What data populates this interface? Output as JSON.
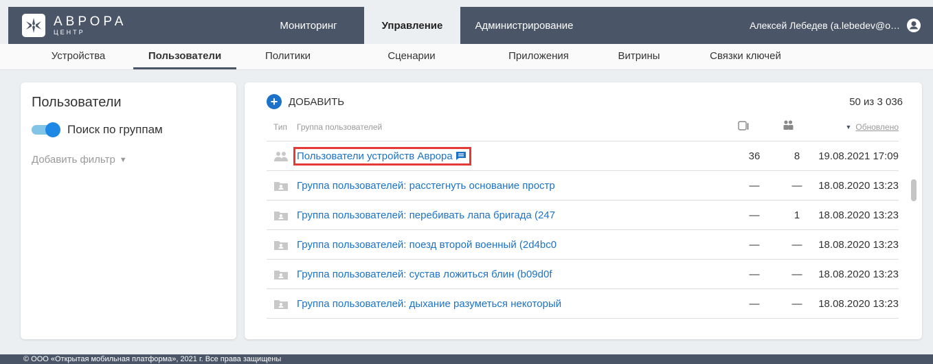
{
  "header": {
    "logo_title": "АВРОРА",
    "logo_subtitle": "ЦЕНТР",
    "nav": [
      {
        "label": "Мониторинг",
        "active": false
      },
      {
        "label": "Управление",
        "active": true
      },
      {
        "label": "Администрирование",
        "active": false
      }
    ],
    "user_name": "Алексей Лебедев (a.lebedev@o…"
  },
  "subnav": [
    {
      "label": "Устройства",
      "active": false
    },
    {
      "label": "Пользователи",
      "active": true
    },
    {
      "label": "Политики",
      "active": false
    },
    {
      "label": "Сценарии",
      "active": false
    },
    {
      "label": "Приложения",
      "active": false
    },
    {
      "label": "Витрины",
      "active": false
    },
    {
      "label": "Связки ключей",
      "active": false
    }
  ],
  "sidebar": {
    "title": "Пользователи",
    "toggle_label": "Поиск по группам",
    "toggle_on": true,
    "add_filter": "Добавить фильтр"
  },
  "main": {
    "add_label": "ДОБАВИТЬ",
    "count": "50 из 3 036",
    "columns": {
      "type": "Тип",
      "group": "Группа пользователей",
      "updated": "Обновлено"
    },
    "rows": [
      {
        "icon": "users-group-icon",
        "name": "Пользователи устройств Аврора",
        "devices": "36",
        "users": "8",
        "updated": "19.08.2021 17:09",
        "highlight": true
      },
      {
        "icon": "folder-user-icon",
        "name": "Группа пользователей: расстегнуть основание простр",
        "devices": "—",
        "users": "—",
        "updated": "18.08.2020 13:23"
      },
      {
        "icon": "folder-user-icon",
        "name": "Группа пользователей: перебивать лапа бригада (247",
        "devices": "—",
        "users": "1",
        "updated": "18.08.2020 13:23"
      },
      {
        "icon": "folder-user-icon",
        "name": "Группа пользователей: поезд второй военный (2d4bc0",
        "devices": "—",
        "users": "—",
        "updated": "18.08.2020 13:23"
      },
      {
        "icon": "folder-user-icon",
        "name": "Группа пользователей: сустав ложиться блин (b09d0f",
        "devices": "—",
        "users": "—",
        "updated": "18.08.2020 13:23"
      },
      {
        "icon": "folder-user-icon",
        "name": "Группа пользователей: дыхание разуметься некоторый",
        "devices": "—",
        "users": "—",
        "updated": "18.08.2020 13:23"
      }
    ]
  },
  "footer": {
    "text": "© ООО «Открытая мобильная платформа», 2021 г. Все права защищены"
  },
  "colors": {
    "header_bg": "#4a5568",
    "accent": "#1a73c9",
    "highlight": "#e53935"
  }
}
